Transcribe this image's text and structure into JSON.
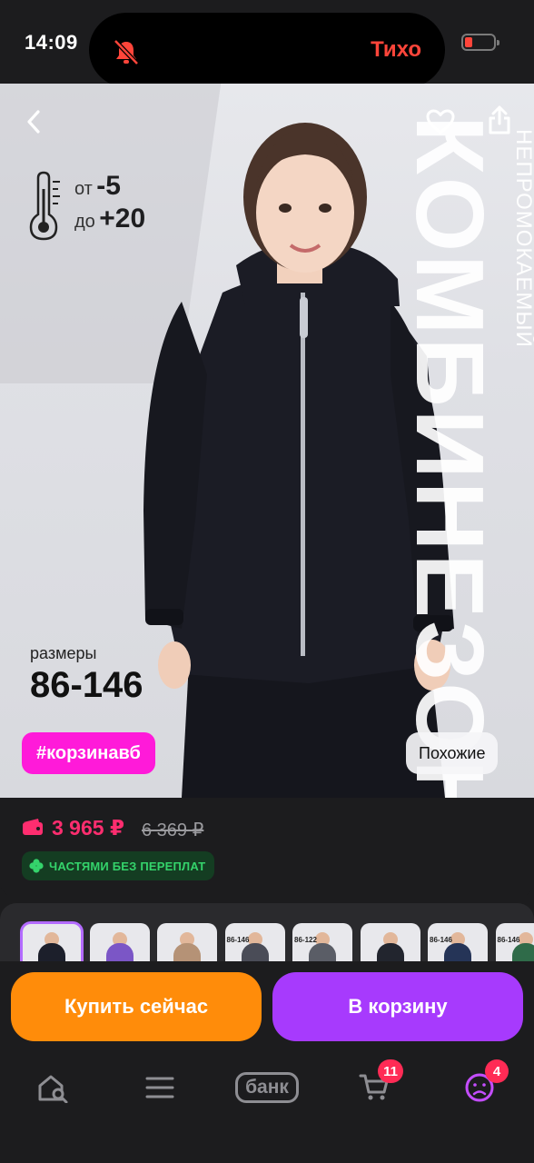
{
  "status_bar": {
    "time": "14:09",
    "mode": "Тихо",
    "bell_icon": "bell-slash-icon",
    "battery_icon": "battery-low-icon"
  },
  "product_image": {
    "back_icon": "chevron-left-icon",
    "favorite_icon": "heart-icon",
    "share_icon": "share-icon",
    "thermometer_icon": "thermometer-icon",
    "temp_from_label": "от",
    "temp_from_value": "-5",
    "temp_to_label": "до",
    "temp_to_value": "+20",
    "vertical_title": "КОМБИНЕЗОН",
    "vertical_subtitle": "НЕПРОМОКАЕМЫЙ",
    "sizes_label": "размеры",
    "sizes_value": "86-146",
    "hashtag": "#корзинавб",
    "similar_button": "Похожие"
  },
  "price": {
    "current": "3 965 ₽",
    "old": "6 369 ₽",
    "wallet_icon": "wallet-icon",
    "installment_text": "ЧАСТЯМИ БЕЗ ПЕРЕПЛАТ",
    "installment_icon": "clover-icon"
  },
  "thumbnails": [
    {
      "label": "",
      "color": "#1c1f2b"
    },
    {
      "label": "",
      "color": "#7b56c6"
    },
    {
      "label": "",
      "color": "#b59276"
    },
    {
      "label": "86-146",
      "color": "#4a4c57"
    },
    {
      "label": "86-122",
      "color": "#5a5d66"
    },
    {
      "label": "",
      "color": "#22252e"
    },
    {
      "label": "86-146",
      "color": "#253457"
    },
    {
      "label": "86-146",
      "color": "#2f6b49"
    }
  ],
  "actions": {
    "buy_now": "Купить сейчас",
    "add_to_cart": "В корзину"
  },
  "nav": {
    "home_icon": "home-search-icon",
    "menu_icon": "menu-icon",
    "bank_label": "банк",
    "cart_icon": "cart-icon",
    "cart_badge": "11",
    "profile_icon": "profile-sad-icon",
    "profile_badge": "4"
  },
  "colors": {
    "accent_purple": "#a73afd",
    "accent_orange": "#ff8c0a",
    "price_pink": "#ff2d6f",
    "hashtag_pink": "#ff1ad9",
    "badge_red": "#ff2b55",
    "installment_green": "#34d36b"
  }
}
